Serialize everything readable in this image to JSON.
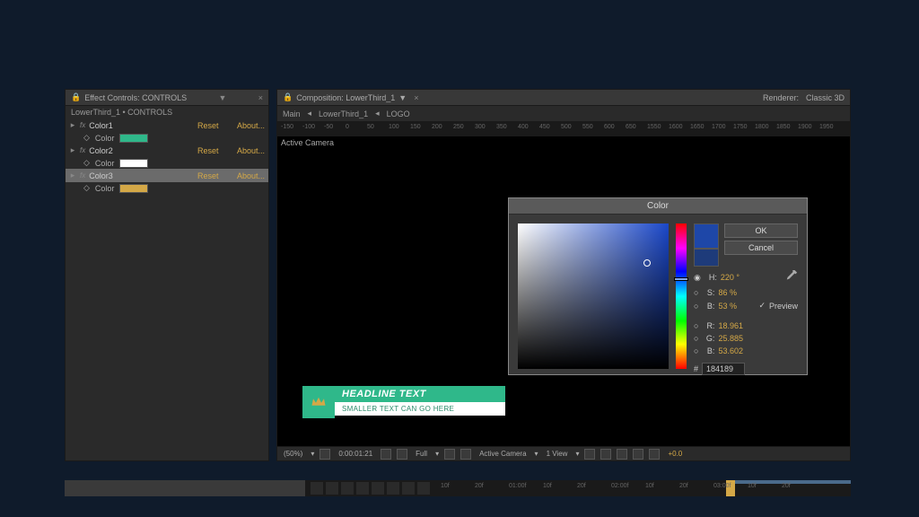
{
  "effects": {
    "tab_title": "Effect Controls: CONTROLS",
    "subhead": "LowerThird_1 • CONTROLS",
    "items": [
      {
        "name": "Color1",
        "reset": "Reset",
        "about": "About...",
        "sub": "Color",
        "swatch": "#2fb88a",
        "selected": false
      },
      {
        "name": "Color2",
        "reset": "Reset",
        "about": "About...",
        "sub": "Color",
        "swatch": "#ffffff",
        "selected": false
      },
      {
        "name": "Color3",
        "reset": "Reset",
        "about": "About...",
        "sub": "Color",
        "swatch": "#d4a847",
        "selected": true
      }
    ]
  },
  "comp": {
    "tab_title": "Composition: LowerThird_1",
    "breadcrumb_main": "Main",
    "breadcrumb_1": "LowerThird_1",
    "breadcrumb_2": "LOGO",
    "renderer_label": "Renderer:",
    "renderer_value": "Classic 3D",
    "active_camera": "Active Camera",
    "ruler_ticks": [
      "-150",
      "-100",
      "-50",
      "0",
      "50",
      "100",
      "150",
      "200",
      "250",
      "300",
      "350",
      "400",
      "450",
      "500",
      "550",
      "600",
      "650",
      "1550",
      "1600",
      "1650",
      "1700",
      "1750",
      "1800",
      "1850",
      "1900",
      "1950"
    ]
  },
  "lower_third": {
    "headline": "HEADLINE TEXT",
    "sub": "SMALLER TEXT CAN GO HERE"
  },
  "comp_bottom": {
    "zoom": "(50%)",
    "timecode": "0:00:01:21",
    "res": "Full",
    "camera": "Active Camera",
    "view": "1 View",
    "exposure": "+0.0"
  },
  "color_picker": {
    "title": "Color",
    "ok": "OK",
    "cancel": "Cancel",
    "preview": "Preview",
    "H_label": "H:",
    "H_val": "220 °",
    "S_label": "S:",
    "S_val": "86 %",
    "B_label": "B:",
    "B_val": "53 %",
    "R_label": "R:",
    "R_val": "18.961",
    "G_label": "G:",
    "G_val": "25.885",
    "Bb_label": "B:",
    "Bb_val": "53.602",
    "hex": "184189",
    "new_color": "#1e47a8",
    "old_color": "#1e3b7a",
    "field_x_pct": 86,
    "field_y_pct": 27,
    "hue_y_pct": 38
  },
  "timeline": {
    "ticks": [
      "10f",
      "20f",
      "01:00f",
      "10f",
      "20f",
      "02:00f",
      "10f",
      "20f",
      "03:00f",
      "10f",
      "20f"
    ],
    "playhead_pct": 71,
    "wa_start_pct": 70,
    "wa_end_pct": 100
  }
}
